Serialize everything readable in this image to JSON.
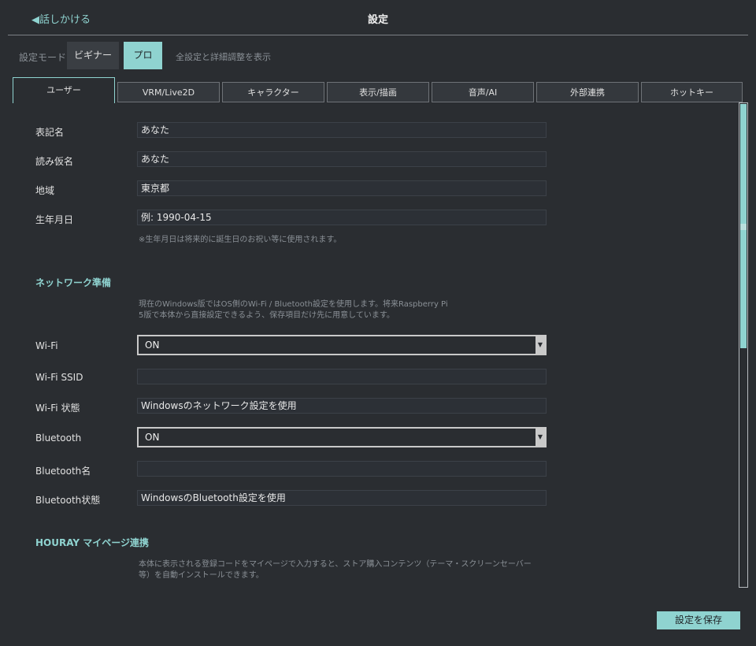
{
  "header": {
    "back_label": "◀話しかける",
    "title": "設定"
  },
  "mode": {
    "label": "設定モード",
    "beginner": "ビギナー",
    "pro": "プロ",
    "description": "全設定と詳細調整を表示"
  },
  "tabs": [
    {
      "label": "ユーザー",
      "active": true
    },
    {
      "label": "VRM/Live2D"
    },
    {
      "label": "キャラクター"
    },
    {
      "label": "表示/描画"
    },
    {
      "label": "音声/AI"
    },
    {
      "label": "外部連携"
    },
    {
      "label": "ホットキー"
    }
  ],
  "user": {
    "display_name": {
      "label": "表記名",
      "value": "あなた"
    },
    "reading": {
      "label": "読み仮名",
      "value": "あなた"
    },
    "region": {
      "label": "地域",
      "value": "東京都"
    },
    "birthday": {
      "label": "生年月日",
      "placeholder": "例: 1990-04-15",
      "note": "※生年月日は将来的に誕生日のお祝い等に使用されます。"
    }
  },
  "network": {
    "title": "ネットワーク準備",
    "note_line1": "現在のWindows版ではOS側のWi-Fi / Bluetooth設定を使用します。将来Raspberry Pi",
    "note_line2": "5版で本体から直接設定できるよう、保存項目だけ先に用意しています。",
    "wifi": {
      "label": "Wi-Fi",
      "value": "ON"
    },
    "wifi_ssid": {
      "label": "Wi-Fi SSID",
      "value": ""
    },
    "wifi_status": {
      "label": "Wi-Fi 状態",
      "value": "Windowsのネットワーク設定を使用"
    },
    "bluetooth": {
      "label": "Bluetooth",
      "value": "ON"
    },
    "bluetooth_name": {
      "label": "Bluetooth名",
      "value": ""
    },
    "bluetooth_status": {
      "label": "Bluetooth状態",
      "value": "WindowsのBluetooth設定を使用"
    }
  },
  "houray": {
    "title": "HOURAY マイページ連携",
    "note_line1": "本体に表示される登録コードをマイページで入力すると、ストア購入コンテンツ（テーマ・スクリーンセーバー",
    "note_line2": "等）を自動インストールできます。"
  },
  "footer": {
    "save_label": "設定を保存"
  },
  "colors": {
    "accent": "#8fd3d0",
    "background": "#2a2d31",
    "field": "#2c3036"
  }
}
